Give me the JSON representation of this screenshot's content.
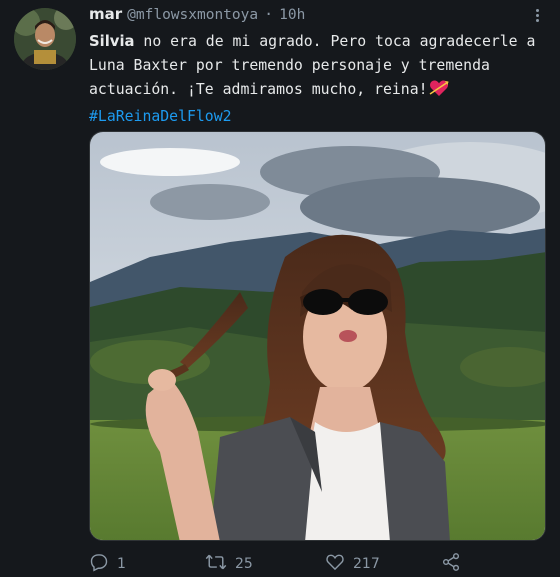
{
  "author": {
    "display_name": "mar",
    "handle": "@mflowsxmontoya",
    "separator": "·",
    "time": "10h",
    "avatar_icon": "user-avatar"
  },
  "tweet": {
    "mention": "Silvia",
    "text": " no era de mi agrado. Pero toca agradecerle a Luna Baxter por tremendo personaje y tremenda actuación. ¡Te admiramos mucho, reina!",
    "emoji": "heart-with-arrow-emoji",
    "hashtag": "#LaReinaDelFlow2"
  },
  "media": {
    "icon": "photo-woman-sunglasses-mountains"
  },
  "actions": {
    "reply_count": "1",
    "retweet_count": "25",
    "like_count": "217"
  },
  "colors": {
    "background": "#15181c",
    "text": "#e7e9ea",
    "secondary": "#8b98a5",
    "link": "#1d9bf0"
  }
}
